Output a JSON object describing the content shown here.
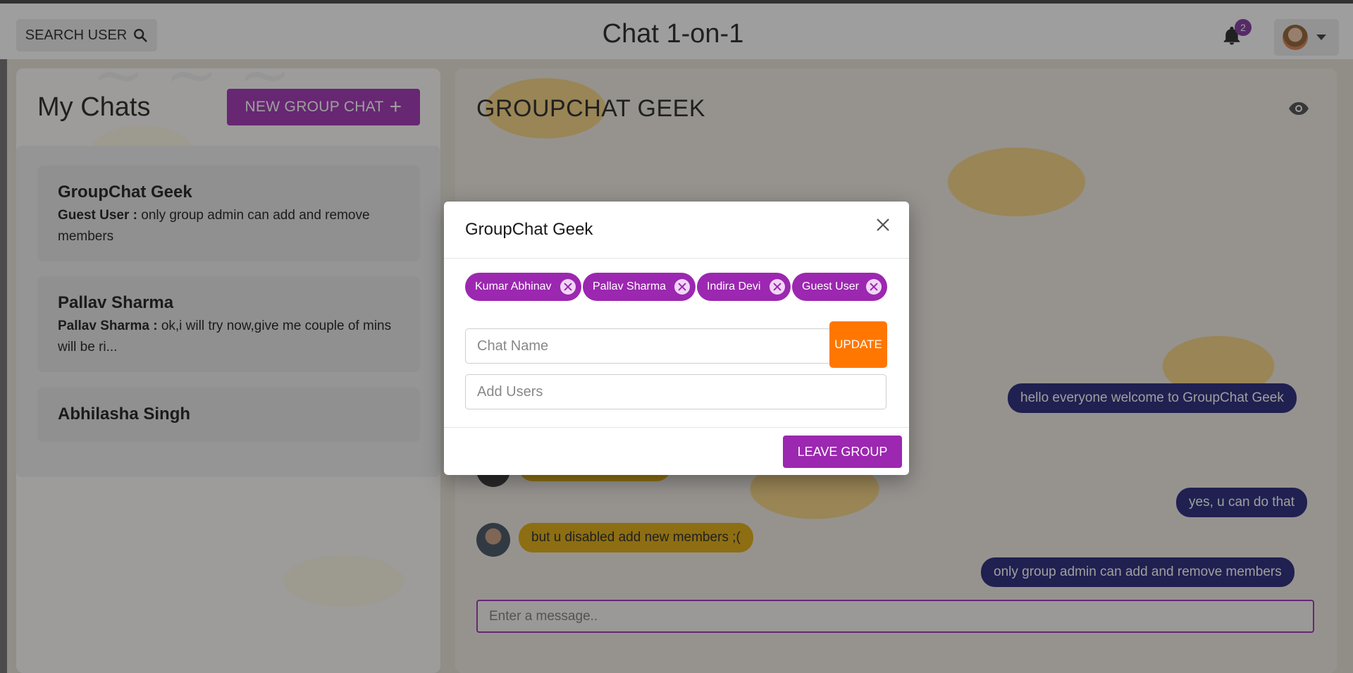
{
  "header": {
    "search_label": "SEARCH USER",
    "app_title": "Chat 1-on-1",
    "notification_count": "2"
  },
  "left_panel": {
    "title": "My Chats",
    "new_group_label": "NEW GROUP CHAT",
    "chats": [
      {
        "name": "GroupChat Geek",
        "sender": "Guest User :",
        "message": "only group admin can add and remove members"
      },
      {
        "name": "Pallav Sharma",
        "sender": "Pallav Sharma :",
        "message": "ok,i will try now,give me couple of mins will be ri..."
      },
      {
        "name": "Abhilasha Singh"
      }
    ]
  },
  "chat_panel": {
    "title": "GROUPCHAT GEEK",
    "messages": [
      {
        "text": "hello everyone welcome to GroupChat Geek",
        "side": "right"
      },
      {
        "text": "yes, u can do that",
        "side": "right"
      },
      {
        "text": "but u disabled add new members ;(",
        "side": "left"
      },
      {
        "text": "only group admin can add and remove members",
        "side": "right"
      }
    ],
    "input_placeholder": "Enter a message.."
  },
  "modal": {
    "title": "GroupChat Geek",
    "members": [
      "Kumar Abhinav",
      "Pallav Sharma",
      "Indira Devi",
      "Guest User"
    ],
    "chat_name_placeholder": "Chat Name",
    "update_label": "UPDATE",
    "add_users_placeholder": "Add Users",
    "leave_label": "LEAVE GROUP"
  },
  "colors": {
    "accent_purple": "#9c27b0",
    "update_orange": "#ff7700",
    "own_message": "#1b1a73",
    "other_message": "#e0a800"
  }
}
